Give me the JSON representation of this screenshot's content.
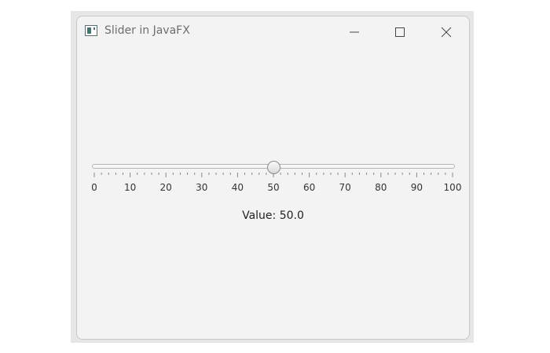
{
  "window": {
    "title": "Slider in JavaFX",
    "buttons": [
      "minimize-icon",
      "maximize-icon",
      "close-icon"
    ]
  },
  "slider": {
    "min": 0,
    "max": 100,
    "value": 50,
    "major_tick_unit": 10,
    "minor_tick_count": 4,
    "tick_labels": [
      "0",
      "10",
      "20",
      "30",
      "40",
      "50",
      "60",
      "70",
      "80",
      "90",
      "100"
    ]
  },
  "value_label": "Value: 50.0",
  "colors": {
    "window_bg": "#f3f3f3",
    "track_border": "#b4b4b4",
    "tick": "#8a8a8a"
  }
}
